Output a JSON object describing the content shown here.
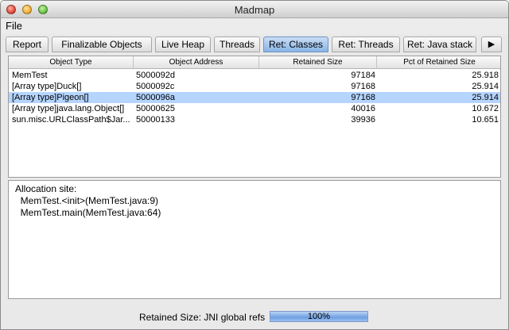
{
  "window": {
    "title": "Madmap"
  },
  "menubar": {
    "file": "File"
  },
  "tabs": [
    {
      "label": "Report",
      "active": false
    },
    {
      "label": "Finalizable Objects",
      "active": false
    },
    {
      "label": "Live Heap",
      "active": false
    },
    {
      "label": "Threads",
      "active": false
    },
    {
      "label": "Ret: Classes",
      "active": true
    },
    {
      "label": "Ret: Threads",
      "active": false
    },
    {
      "label": "Ret: Java stack",
      "active": false
    }
  ],
  "tab_scroll": {
    "icon": "right-arrow-icon",
    "glyph": "▶"
  },
  "table": {
    "columns": [
      "Object Type",
      "Object Address",
      "Retained Size",
      "Pct of Retained Size"
    ],
    "rows": [
      [
        "MemTest",
        "5000092d",
        "97184",
        "25.918"
      ],
      [
        "[Array type]Duck[]",
        "5000092c",
        "97168",
        "25.914"
      ],
      [
        "[Array type]Pigeon[]",
        "5000096a",
        "97168",
        "25.914"
      ],
      [
        "[Array type]java.lang.Object[]",
        "50000625",
        "40016",
        "10.672"
      ],
      [
        "sun.misc.URLClassPath$Jar...",
        "50000133",
        "39936",
        "10.651"
      ]
    ],
    "selected_row": 2
  },
  "detail": {
    "lines": [
      "Allocation site:",
      "  MemTest.<init>(MemTest.java:9)",
      "  MemTest.main(MemTest.java:64)"
    ]
  },
  "status": {
    "label": "Retained Size: JNI global refs",
    "progress_text": "100%",
    "progress_fraction": 1.0
  },
  "colors": {
    "selection": "#b5d5ff",
    "active_tab": "#89b4e6"
  }
}
